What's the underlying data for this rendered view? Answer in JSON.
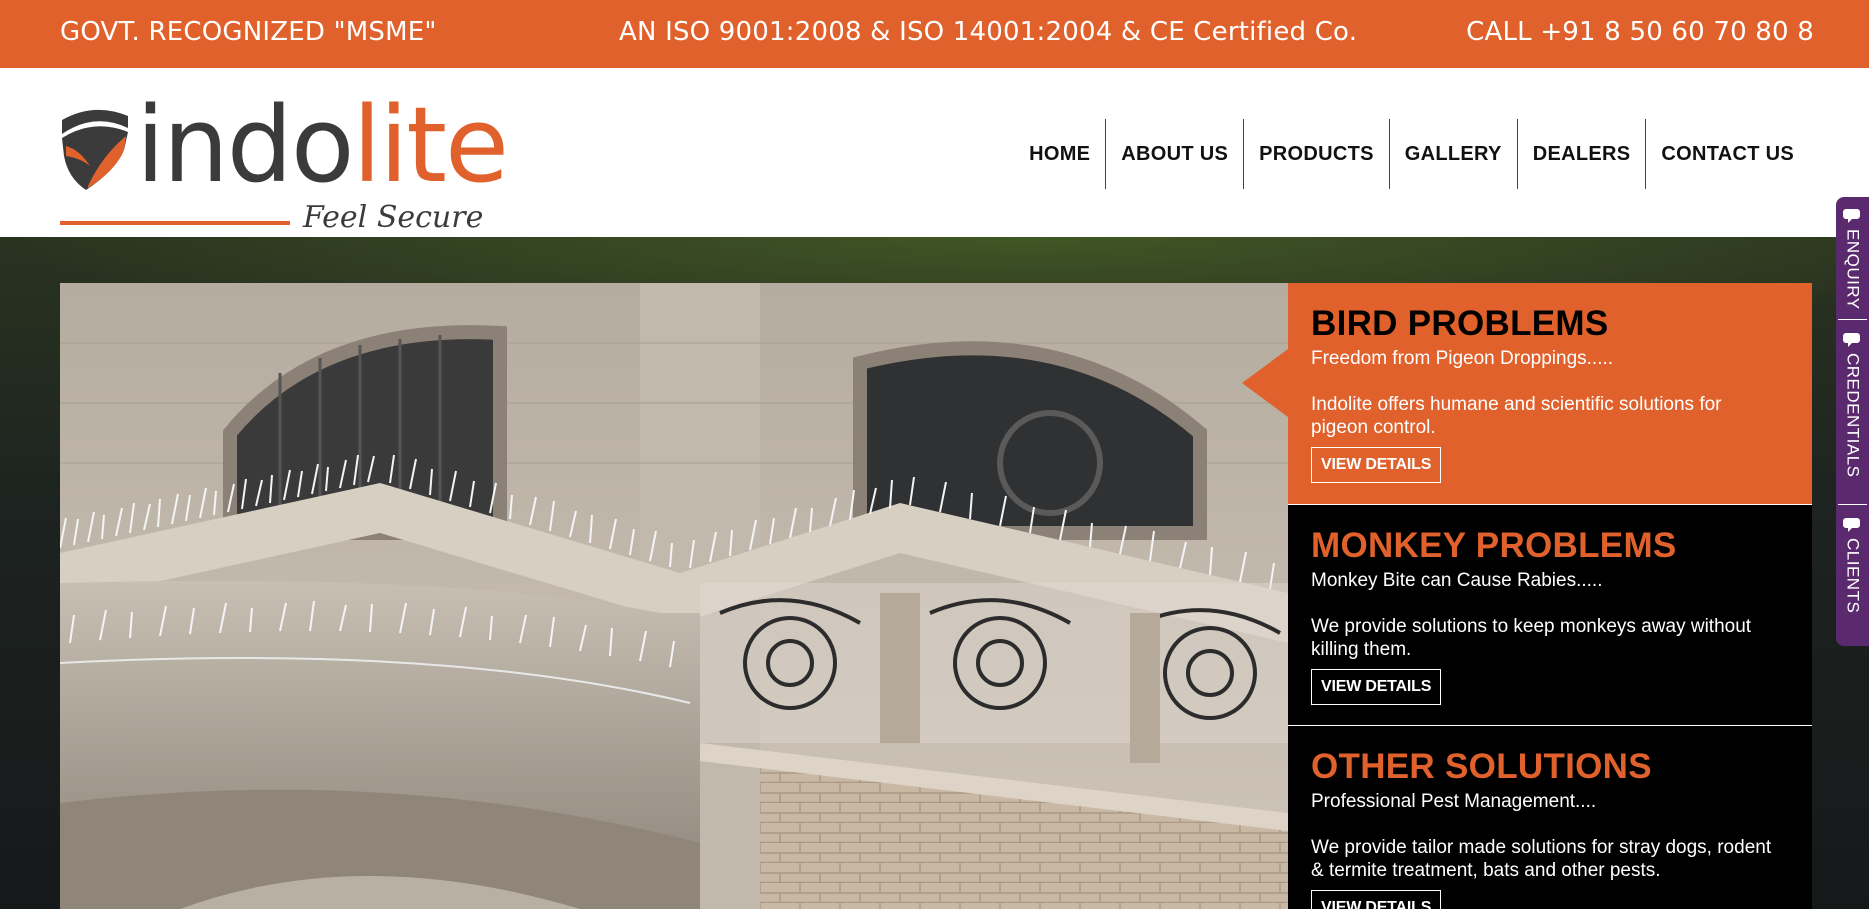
{
  "topbar": {
    "left": "GOVT. RECOGNIZED \"MSME\"",
    "center": "AN ISO 9001:2008 & ISO 14001:2004 & CE Certified Co.",
    "right": "CALL +91 8 50 60 70 80 8"
  },
  "logo": {
    "word_dark": "indo",
    "word_orange": "lite",
    "tagline": "Feel Secure"
  },
  "nav": {
    "items": [
      {
        "label": "HOME"
      },
      {
        "label": "ABOUT US"
      },
      {
        "label": "PRODUCTS"
      },
      {
        "label": "GALLERY"
      },
      {
        "label": "DEALERS"
      },
      {
        "label": "CONTACT US"
      }
    ]
  },
  "cards": [
    {
      "title": "BIRD PROBLEMS",
      "subtitle": "Freedom from Pigeon Droppings.....",
      "description": "Indolite offers humane and scientific solutions for pigeon control.",
      "button": "VIEW DETAILS"
    },
    {
      "title": "MONKEY PROBLEMS",
      "subtitle": "Monkey Bite can Cause Rabies.....",
      "description": "We provide solutions to keep monkeys away without killing them.",
      "button": "VIEW DETAILS"
    },
    {
      "title": "OTHER SOLUTIONS",
      "subtitle": "Professional Pest Management....",
      "description": "We provide tailor made solutions for stray dogs, rodent & termite treatment, bats and other pests.",
      "button": "VIEW DETAILS"
    }
  ],
  "sidetabs": [
    {
      "label": "ENQUIRY",
      "icon": "chat-icon"
    },
    {
      "label": "CREDENTIALS",
      "icon": "chat-icon"
    },
    {
      "label": "CLIENTS",
      "icon": "chat-icon"
    }
  ],
  "colors": {
    "accent": "#e0612c",
    "dark": "#3b3b3b",
    "sidetab": "#5b2a6e"
  }
}
